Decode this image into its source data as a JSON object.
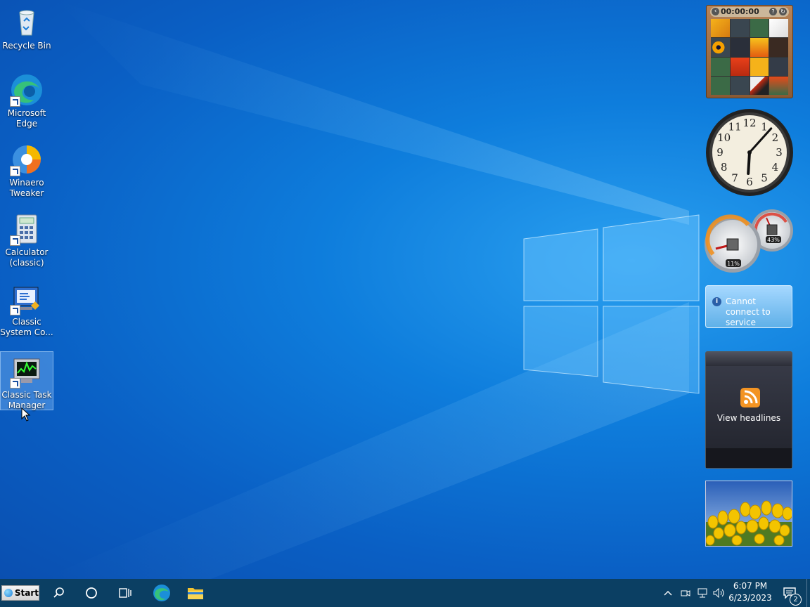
{
  "desktop_icons": [
    {
      "label": "Recycle Bin",
      "icon": "recycle-bin-icon"
    },
    {
      "label": "Microsoft Edge",
      "icon": "edge-icon"
    },
    {
      "label": "Winaero Tweaker",
      "icon": "winaero-tweaker-icon"
    },
    {
      "label": "Calculator (classic)",
      "icon": "calculator-icon"
    },
    {
      "label": "Classic System Co...",
      "icon": "classic-system-control-icon"
    },
    {
      "label": "Classic Task Manager",
      "icon": "task-manager-icon",
      "selected": true
    }
  ],
  "gadgets": {
    "puzzle": {
      "timer": "00:00:00"
    },
    "clock": {
      "hour": 6,
      "minute": 7,
      "numerals": [
        "12",
        "1",
        "2",
        "3",
        "4",
        "5",
        "6",
        "7",
        "8",
        "9",
        "10",
        "11"
      ]
    },
    "cpu_meter": {
      "cpu_percent": "11%",
      "memory_percent": "43%"
    },
    "weather": {
      "message": "Cannot connect to service"
    },
    "feed": {
      "label": "View headlines"
    }
  },
  "taskbar": {
    "start_label": "Start",
    "time": "6:07 PM",
    "date": "6/23/2023",
    "notification_count": "2"
  },
  "colors": {
    "desktop_blue": "#0a6fd6",
    "taskbar": "#0b3f63"
  }
}
